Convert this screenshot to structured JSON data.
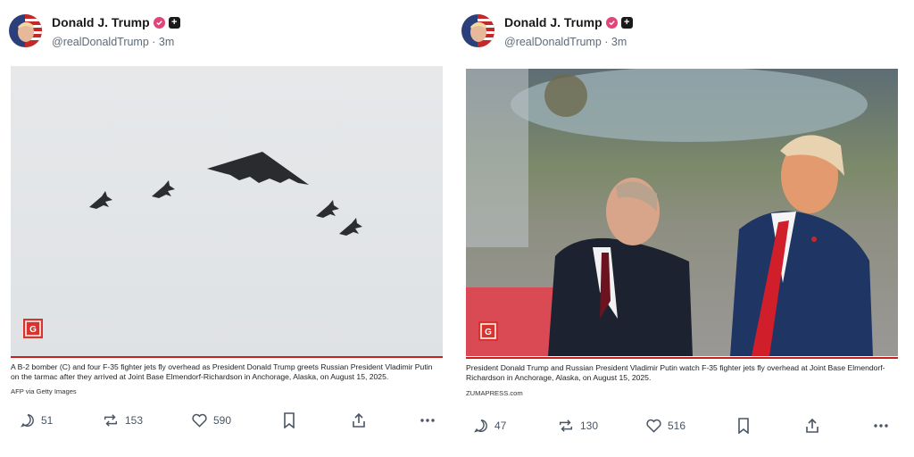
{
  "posts": [
    {
      "author": {
        "name": "Donald J. Trump",
        "handle": "@realDonaldTrump",
        "time": "3m"
      },
      "caption": "A B-2 bomber (C) and four F-35 fighter jets fly overhead as President Donald Trump greets Russian President Vladimir Putin on the tarmac after they arrived at Joint Base Elmendorf-Richardson in Anchorage, Alaska, on August 15, 2025.",
      "credit": "AFP via Getty Images",
      "image_logo": "G",
      "stats": {
        "replies": "51",
        "retruths": "153",
        "likes": "590"
      }
    },
    {
      "author": {
        "name": "Donald J. Trump",
        "handle": "@realDonaldTrump",
        "time": "3m"
      },
      "caption": "President Donald Trump and Russian President Vladimir Putin watch F-35 fighter jets fly overhead at Joint Base Elmendorf-Richardson in Anchorage, Alaska, on August 15, 2025.",
      "credit": "ZUMAPRESS.com",
      "image_logo": "G",
      "stats": {
        "replies": "47",
        "retruths": "130",
        "likes": "516"
      }
    }
  ],
  "icons": [
    "reply-icon",
    "retruth-icon",
    "like-icon",
    "bookmark-icon",
    "share-icon",
    "more-icon",
    "verified-icon",
    "plus-badge-icon"
  ],
  "colors": {
    "accent_red": "#cc1f1f",
    "verified_pink": "#e0457b",
    "muted_text": "#5e6a78"
  }
}
